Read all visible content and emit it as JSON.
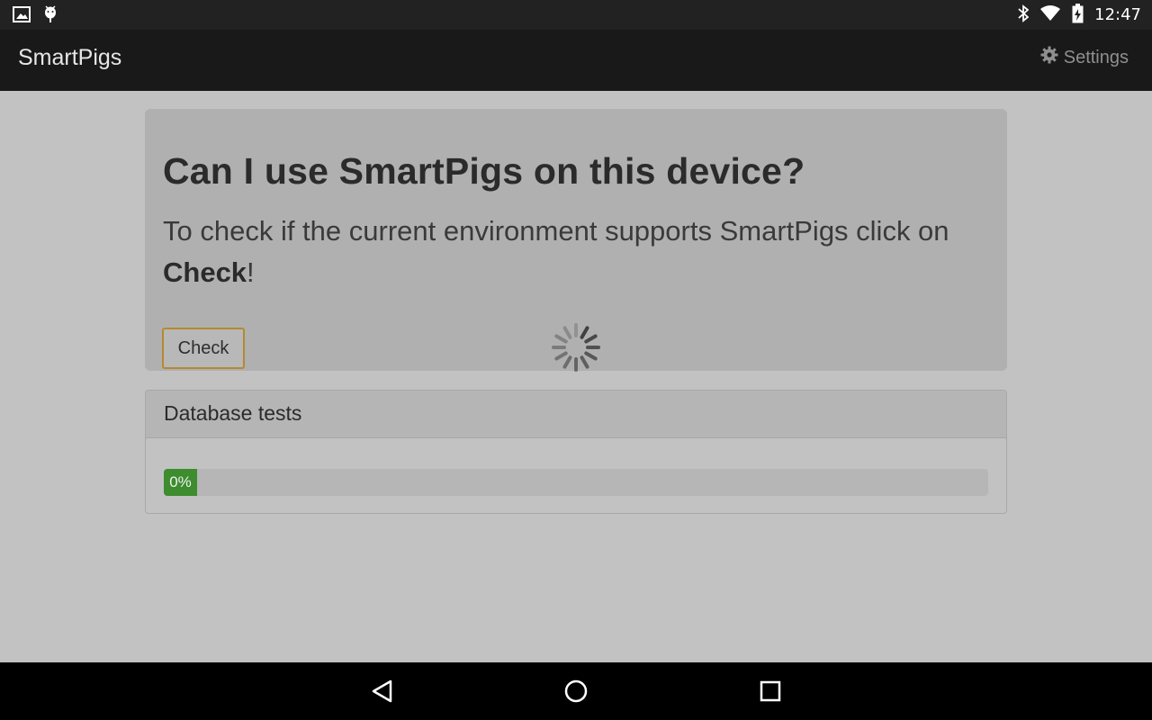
{
  "status_bar": {
    "time": "12:47",
    "left_icons": [
      "image-icon",
      "android-debug-icon"
    ],
    "right_icons": [
      "bluetooth-icon",
      "wifi-icon",
      "battery-icon"
    ]
  },
  "app_bar": {
    "title": "SmartPigs",
    "settings_label": "Settings"
  },
  "jumbotron": {
    "heading": "Can I use SmartPigs on this device?",
    "lead_text": "To check if the current environment supports SmartPigs click on ",
    "lead_emphasis": "Check",
    "lead_suffix": "!",
    "button_label": "Check",
    "loading": true
  },
  "panel": {
    "title": "Database tests",
    "progress": {
      "value_percent": 0,
      "label": "0%",
      "color": "#3d8c2e"
    }
  },
  "nav_bar": {
    "buttons": [
      "back-icon",
      "home-icon",
      "recents-icon"
    ]
  }
}
